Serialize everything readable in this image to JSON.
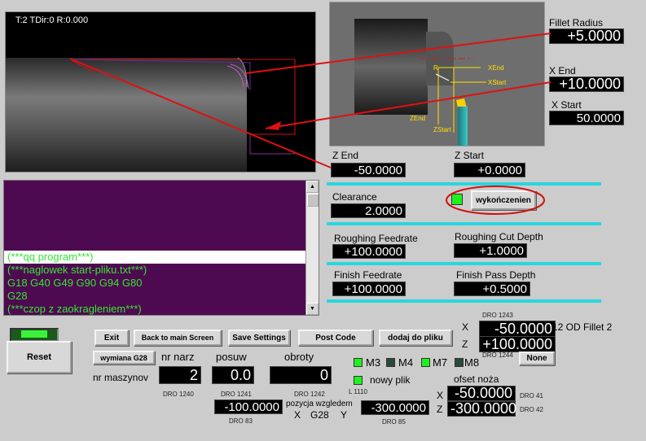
{
  "viewport": {
    "status": "T:2 TDir:0 R:0.000"
  },
  "diagram": {
    "labels": {
      "r": "R",
      "xend": "XEnd",
      "xstart": "XStart",
      "zend": "ZEnd",
      "zstart": "ZStart"
    }
  },
  "fillet_radius": {
    "label": "Fillet Radius",
    "value": "+5.0000"
  },
  "x_end": {
    "label": "X End",
    "value": "+10.0000"
  },
  "x_start": {
    "label": "X Start",
    "value": "50.0000"
  },
  "z_end": {
    "label": "Z End",
    "value": "-50.0000"
  },
  "z_start": {
    "label": "Z Start",
    "value": "+0.0000"
  },
  "clearance": {
    "label": "Clearance",
    "value": "2.0000"
  },
  "finish_button": {
    "label": "wykończenien"
  },
  "roughing_feedrate": {
    "label": "Roughing Feedrate",
    "value": "+100.0000"
  },
  "roughing_cut_depth": {
    "label": "Roughing Cut Depth",
    "value": "+1.0000"
  },
  "finish_feedrate": {
    "label": "Finish Feedrate",
    "value": "+100.0000"
  },
  "finish_pass_depth": {
    "label": "Finish Pass Depth",
    "value": "+0.5000"
  },
  "console": {
    "lines": [
      "",
      "",
      "",
      "",
      "",
      "(***qq program***)",
      "(***naglowek start-pliku.txt***)",
      "G18 G40 G49 G90 G94 G80",
      "G28",
      "(***czop z zaokragleniem***)"
    ]
  },
  "buttons": {
    "exit": "Exit",
    "back": "Back to main Screen",
    "save": "Save Settings",
    "post": "Post Code",
    "dodaj": "dodaj do pliku",
    "reset": "Reset",
    "wymiana": "wymiana G28",
    "none": "None"
  },
  "headers": {
    "nr_narz": "nr narz",
    "posuw": "posuw",
    "obroty": "obroty",
    "nr_maszynov": "nr maszynov"
  },
  "dros": {
    "tool": {
      "value": "2",
      "id": "DRO 1240"
    },
    "feed": {
      "value": "0.0",
      "id": "DRO 1241"
    },
    "speed": {
      "value": "0",
      "id": "DRO 1242"
    },
    "pos_x": {
      "value": "-100.0000",
      "id": "DRO 83"
    },
    "pos_y": {
      "value": "-300.0000",
      "id": "DRO 85"
    },
    "top_x": {
      "value": "-50.0000",
      "id": "DRO 1243"
    },
    "top_z": {
      "value": "+100.0000",
      "id": "DRO 1244"
    },
    "off_x": {
      "value": "-50.0000",
      "id": "DRO 41"
    },
    "off_z": {
      "value": "-300.0000",
      "id": "DRO 42"
    }
  },
  "pozycja": {
    "label": "pozycja wzgledem",
    "x": "X",
    "g28": "G28",
    "y": "Y"
  },
  "axis": {
    "x": "X",
    "z": "Z"
  },
  "program_title": "12 OD Fillet 2",
  "mcodes": {
    "m3": "M3",
    "m4": "M4",
    "m7": "M7",
    "m8": "M8"
  },
  "nowy_plik": {
    "label": "nowy plik",
    "id": "L 1110"
  },
  "ofset": {
    "label": "ofset noża"
  }
}
